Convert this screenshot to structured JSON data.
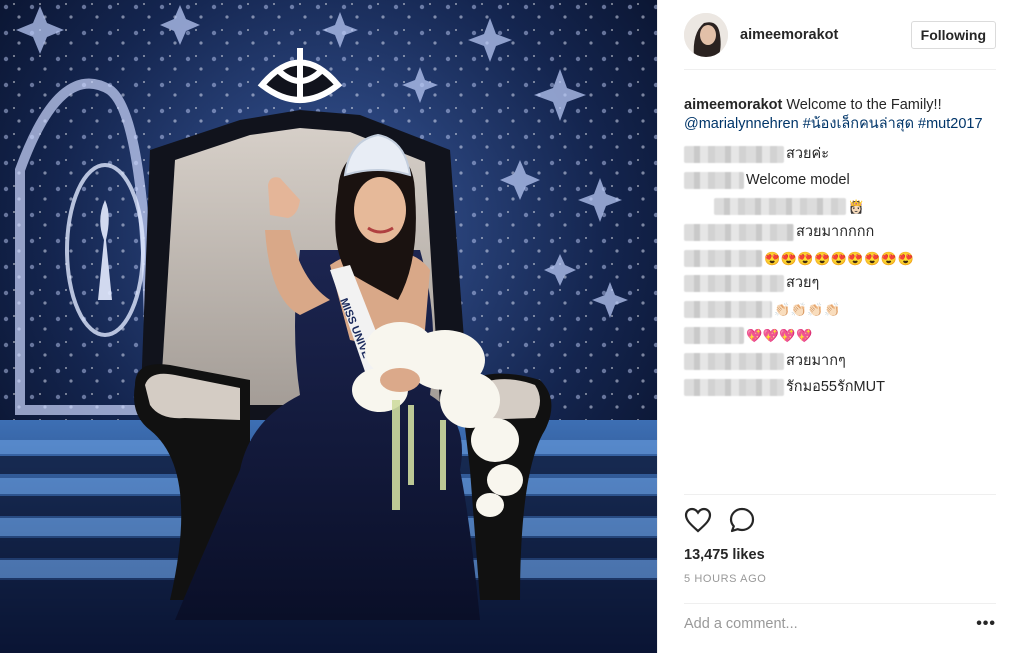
{
  "post": {
    "username": "aimeemorakot",
    "follow_label": "Following",
    "caption": {
      "username": "aimeemorakot",
      "text": "Welcome to the Family!!",
      "mention": "@marialynnehren",
      "hashtag1": "#น้องเล็กคนล่าสุด",
      "hashtag2": "#mut2017"
    },
    "comments": [
      {
        "text": "สวยค่ะ",
        "emoji": ""
      },
      {
        "text": "Welcome model",
        "emoji": ""
      },
      {
        "text": "",
        "emoji": "👸🏻"
      },
      {
        "text": "สวยมากกกก",
        "emoji": ""
      },
      {
        "text": "",
        "emoji": "😍😍😍😍😍😍😍😍😍"
      },
      {
        "text": "สวยๆ",
        "emoji": ""
      },
      {
        "text": "",
        "emoji": "👏🏻👏🏻👏🏻👏🏻"
      },
      {
        "text": "",
        "emoji": "💖💖💖💖"
      },
      {
        "text": "สวยมากๆ",
        "emoji": ""
      },
      {
        "text": "รักมอ55รักMUT",
        "emoji": ""
      }
    ],
    "likes": "13,475 likes",
    "time": "5 HOURS AGO",
    "comment_placeholder": "Add a comment...",
    "more_label": "•••"
  },
  "colors": {
    "link": "#003569",
    "border": "#efefef",
    "muted": "#999999"
  },
  "icons": [
    "heart-icon",
    "comment-icon",
    "more-options-icon"
  ]
}
